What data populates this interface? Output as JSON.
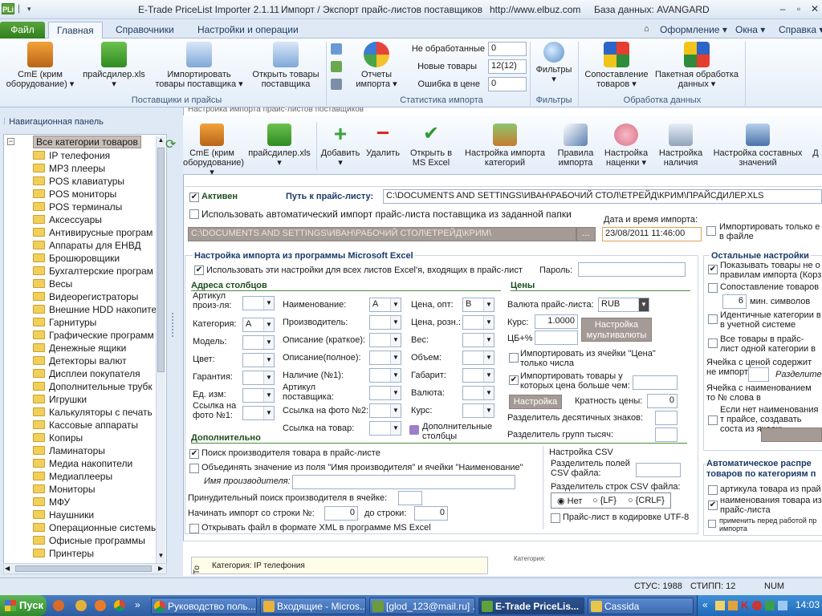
{
  "window": {
    "title_app": "E-Trade PriceList Importer 2.1.11",
    "title_desc": "Импорт / Экспорт прайс-листов поставщиков",
    "title_url": "http://www.elbuz.com",
    "title_db": "База данных: AVANGARD",
    "app_icon": "PLi"
  },
  "ribbon_tabs": [
    "Файл",
    "Главная",
    "Справочники",
    "Настройки и операции"
  ],
  "ribbon_right": [
    "Оформление",
    "Окна",
    "Справка"
  ],
  "ribbon": {
    "supplier_buttons": [
      {
        "label": "CmE (крим оборудование)",
        "icon": "truck-icon"
      },
      {
        "label": "прайсдилер.xls",
        "icon": "excel-icon"
      },
      {
        "label": "Импортировать товары поставщика",
        "icon": "import-icon"
      },
      {
        "label": "Открыть товары поставщика",
        "icon": "open-icon"
      }
    ],
    "group_suppliers": "Поставщики и прайсы",
    "reports_label": "Отчеты импорта",
    "stats": [
      {
        "label": "Не обработанные",
        "value": "0"
      },
      {
        "label": "Новые товары",
        "value": "12(12)"
      },
      {
        "label": "Ошибка в цене",
        "value": "0"
      }
    ],
    "group_stats": "Статистика импорта",
    "filters_label": "Фильтры",
    "group_filters": "Фильтры",
    "compare_label": "Сопоставление товаров",
    "batch_label": "Пакетная обработка данных",
    "group_processing": "Обработка данных"
  },
  "nav": {
    "title": "Навигационная панель",
    "root": "Все категории товаров",
    "items": [
      "IP телефония",
      "MP3 плееры",
      "POS клавиатуры",
      "POS мониторы",
      "POS терминалы",
      "Аксессуары",
      "Антивирусные програм",
      "Аппараты для ЕНВД",
      "Брошюровщики",
      "Бухгалтерские програм",
      "Весы",
      "Видеорегистраторы",
      "Внешние HDD накопите",
      "Гарнитуры",
      "Графические программ",
      "Денежные ящики",
      "Детекторы валют",
      "Дисплеи покупателя",
      "Дополнительные трубк",
      "Игрушки",
      "Калькуляторы с печать",
      "Кассовые аппараты",
      "Копиры",
      "Ламинаторы",
      "Медиа накопители",
      "Медиаплееры",
      "Мониторы",
      "МФУ",
      "Наушники",
      "Операционные системы",
      "Офисные программы",
      "Принтеры"
    ]
  },
  "inner": {
    "caption": "Настройка импорта прайс-листов поставщиков",
    "toolbar": [
      {
        "label": "CmE (крим оборудование)",
        "icon": "truck-icon"
      },
      {
        "label": "прайсдилер.xls",
        "icon": "excel-icon"
      },
      {
        "label": "Добавить",
        "icon": "plus-icon"
      },
      {
        "label": "Удалить",
        "icon": "minus-icon"
      },
      {
        "label": "Открыть в MS Excel",
        "icon": "check-icon"
      },
      {
        "label": "Настройка импорта категорий",
        "icon": "category-icon"
      },
      {
        "label": "Правила импорта",
        "icon": "feather-icon"
      },
      {
        "label": "Настройка наценки",
        "icon": "piggy-icon"
      },
      {
        "label": "Настройка наличия",
        "icon": "cart-icon"
      },
      {
        "label": "Настройка составных значений",
        "icon": "layers-icon"
      },
      {
        "label": "Д",
        "icon": "more-icon"
      }
    ],
    "active_label": "Активен",
    "path_label": "Путь к прайс-листу:",
    "path_value": "C:\\DOCUMENTS AND SETTINGS\\ИВАН\\РАБОЧИЙ СТОЛ\\ЕТРЕЙД\\КРИМ\\ПРАЙСДИЛЕР.XLS",
    "auto_import_label": "Использовать автоматический импорт прайс-листа поставщика из заданной папки",
    "folder_value": "C:\\DOCUMENTS AND SETTINGS\\ИВАН\\РАБОЧИЙ СТОЛ\\ЕТРЕЙД\\КРИМ\\",
    "folder_btn": "...",
    "date_label": "Дата и время импорта:",
    "date_value": "23/08/2011 11:46:00",
    "import_only_label": "Импортировать только е в файле",
    "excel_section": "Настройка импорта из программы Microsoft Excel",
    "use_for_all_label": "Использовать эти настройки для всех листов Excel'я, входящих в прайс-лист",
    "password_label": "Пароль:",
    "columns_section": "Адреса столбцов",
    "prices_section": "Цены",
    "col_labels_1": [
      "Артикул произ-ля:",
      "Категория:",
      "Модель:",
      "Цвет:",
      "Гарантия:",
      "Ед. изм:",
      "Ссылка на фото №1:"
    ],
    "col_labels_2": [
      "Наименование:",
      "Производитель:",
      "Описание (краткое):",
      "Описание(полное):",
      "Наличие (№1):",
      "Артикул поставщика:",
      "Ссылка на фото №2:",
      "Ссылка на товар:"
    ],
    "col_labels_3": [
      "Цена, опт:",
      "Цена, розн.:",
      "Вес:",
      "Объем:",
      "Габарит:",
      "Валюта:",
      "Курс:"
    ],
    "col_val_category": "A",
    "col_val_name": "A",
    "col_val_price": "B",
    "extra_columns": "Дополнительные столбцы",
    "currency_label": "Валюта прайс-листа:",
    "currency_value": "RUB",
    "rate_label": "Курс:",
    "rate_value": "1.0000",
    "multicurrency_btn": "Настройка мультивалюты",
    "cb_label": "ЦБ+%",
    "import_from_cell_label": "Импортировать из ячейки \"Цена\" только числа",
    "import_price_gt_label": "Импортировать товары у которых цена больше чем:",
    "settings_btn": "Настройка",
    "multiplicity_label": "Кратность цены:",
    "multiplicity_value": "0",
    "decimal_sep_label": "Разделитель десятичных знаков:",
    "group_sep_label": "Разделитель групп тысяч:",
    "additional_section": "Дополнительно",
    "search_maker_label": "Поиск производителя товара в прайс-листе",
    "merge_label": "Объединять значение из поля \"Имя производителя\" и ячейки \"Наименование\"",
    "maker_name_label": "Имя производителя:",
    "force_search_label": "Принудительный поиск производителя в ячейке:",
    "start_row_label": "Начинать импорт со строки №:",
    "start_row_value": "0",
    "to_row_label": "до строки:",
    "to_row_value": "0",
    "open_xml_label": "Открывать файл в формате XML в программе MS Excel",
    "csv_section": "Настройка CSV",
    "csv_field_sep": "Разделитель полей CSV файла:",
    "csv_row_sep": "Разделитель строк CSV файла:",
    "csv_opts": [
      "Нет",
      "{LF}",
      "{CRLF}"
    ],
    "csv_utf8": "Прайс-лист в кодировке UTF-8",
    "other_section": "Остальные настройки",
    "other_items": [
      "Показывать товары не о правилам импорта (Корз",
      "Сопоставление товаров",
      "мин. символов",
      "Идентичные категории в в учетной системе",
      "Все товары в прайс-лист одной категории в уч. си",
      "Ячейка с ценой содержит не импорта:",
      "Разделите",
      "Ячейка с наименованием то № слова в наименовании, д",
      "Если нет наименования т прайсе, создавать соста из ячеек:"
    ],
    "compare_min": "6",
    "auto_dist_section": "Автоматическое распре товаров по категориям п",
    "auto_dist_items": [
      "артикула товара из прай",
      "наименования товара из прайс-листа",
      "применить перед работой пр импорта"
    ],
    "bottom_tab": "То",
    "bottom_category": "Категория: IP телефония",
    "bottom_category_small": "Категория:"
  },
  "statusbar": {
    "stus": "СТУС: 1988",
    "stipp": "СТИПП: 12",
    "num": "NUM"
  },
  "taskbar": {
    "start": "Пуск",
    "tasks": [
      "Руководство поль...",
      "Входящие - Micros...",
      "[glod_123@mail.ru] ...",
      "E-Trade PriceLis...",
      "Cassida"
    ],
    "time": "14:03"
  }
}
